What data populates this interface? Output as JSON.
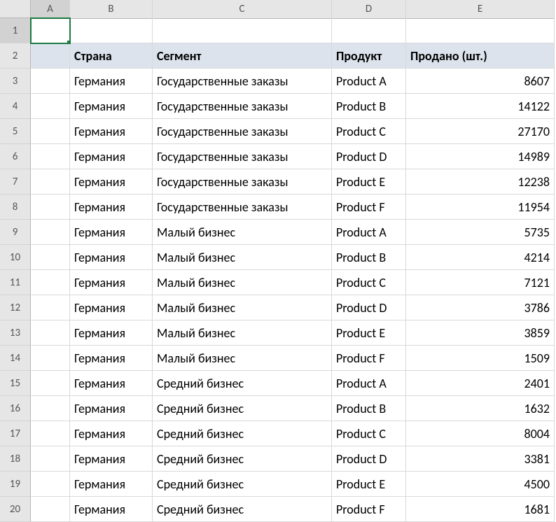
{
  "columns": [
    "A",
    "B",
    "C",
    "D",
    "E"
  ],
  "activeCell": "A1",
  "headers": {
    "country": "Страна",
    "segment": "Сегмент",
    "product": "Продукт",
    "sold": "Продано (шт.)"
  },
  "rows": [
    {
      "n": 3,
      "country": "Германия",
      "segment": "Государственные заказы",
      "product": "Product A",
      "sold": "8607"
    },
    {
      "n": 4,
      "country": "Германия",
      "segment": "Государственные заказы",
      "product": "Product B",
      "sold": "14122"
    },
    {
      "n": 5,
      "country": "Германия",
      "segment": "Государственные заказы",
      "product": "Product C",
      "sold": "27170"
    },
    {
      "n": 6,
      "country": "Германия",
      "segment": "Государственные заказы",
      "product": "Product D",
      "sold": "14989"
    },
    {
      "n": 7,
      "country": "Германия",
      "segment": "Государственные заказы",
      "product": "Product E",
      "sold": "12238"
    },
    {
      "n": 8,
      "country": "Германия",
      "segment": "Государственные заказы",
      "product": "Product F",
      "sold": "11954"
    },
    {
      "n": 9,
      "country": "Германия",
      "segment": "Малый бизнес",
      "product": "Product A",
      "sold": "5735"
    },
    {
      "n": 10,
      "country": "Германия",
      "segment": "Малый бизнес",
      "product": "Product B",
      "sold": "4214"
    },
    {
      "n": 11,
      "country": "Германия",
      "segment": "Малый бизнес",
      "product": "Product C",
      "sold": "7121"
    },
    {
      "n": 12,
      "country": "Германия",
      "segment": "Малый бизнес",
      "product": "Product D",
      "sold": "3786"
    },
    {
      "n": 13,
      "country": "Германия",
      "segment": "Малый бизнес",
      "product": "Product E",
      "sold": "3859"
    },
    {
      "n": 14,
      "country": "Германия",
      "segment": "Малый бизнес",
      "product": "Product F",
      "sold": "1509"
    },
    {
      "n": 15,
      "country": "Германия",
      "segment": "Средний бизнес",
      "product": "Product A",
      "sold": "2401"
    },
    {
      "n": 16,
      "country": "Германия",
      "segment": "Средний бизнес",
      "product": "Product B",
      "sold": "1632"
    },
    {
      "n": 17,
      "country": "Германия",
      "segment": "Средний бизнес",
      "product": "Product C",
      "sold": "8004"
    },
    {
      "n": 18,
      "country": "Германия",
      "segment": "Средний бизнес",
      "product": "Product D",
      "sold": "3381"
    },
    {
      "n": 19,
      "country": "Германия",
      "segment": "Средний бизнес",
      "product": "Product E",
      "sold": "4500"
    },
    {
      "n": 20,
      "country": "Германия",
      "segment": "Средний бизнес",
      "product": "Product F",
      "sold": "1681"
    }
  ],
  "chart_data": {
    "type": "table",
    "title": "",
    "columns": [
      "Страна",
      "Сегмент",
      "Продукт",
      "Продано (шт.)"
    ],
    "data": [
      [
        "Германия",
        "Государственные заказы",
        "Product A",
        8607
      ],
      [
        "Германия",
        "Государственные заказы",
        "Product B",
        14122
      ],
      [
        "Германия",
        "Государственные заказы",
        "Product C",
        27170
      ],
      [
        "Германия",
        "Государственные заказы",
        "Product D",
        14989
      ],
      [
        "Германия",
        "Государственные заказы",
        "Product E",
        12238
      ],
      [
        "Германия",
        "Государственные заказы",
        "Product F",
        11954
      ],
      [
        "Германия",
        "Малый бизнес",
        "Product A",
        5735
      ],
      [
        "Германия",
        "Малый бизнес",
        "Product B",
        4214
      ],
      [
        "Германия",
        "Малый бизнес",
        "Product C",
        7121
      ],
      [
        "Германия",
        "Малый бизнес",
        "Product D",
        3786
      ],
      [
        "Германия",
        "Малый бизнес",
        "Product E",
        3859
      ],
      [
        "Германия",
        "Малый бизнес",
        "Product F",
        1509
      ],
      [
        "Германия",
        "Средний бизнес",
        "Product A",
        2401
      ],
      [
        "Германия",
        "Средний бизнес",
        "Product B",
        1632
      ],
      [
        "Германия",
        "Средний бизнес",
        "Product C",
        8004
      ],
      [
        "Германия",
        "Средний бизнес",
        "Product D",
        3381
      ],
      [
        "Германия",
        "Средний бизнес",
        "Product E",
        4500
      ],
      [
        "Германия",
        "Средний бизнес",
        "Product F",
        1681
      ]
    ]
  }
}
